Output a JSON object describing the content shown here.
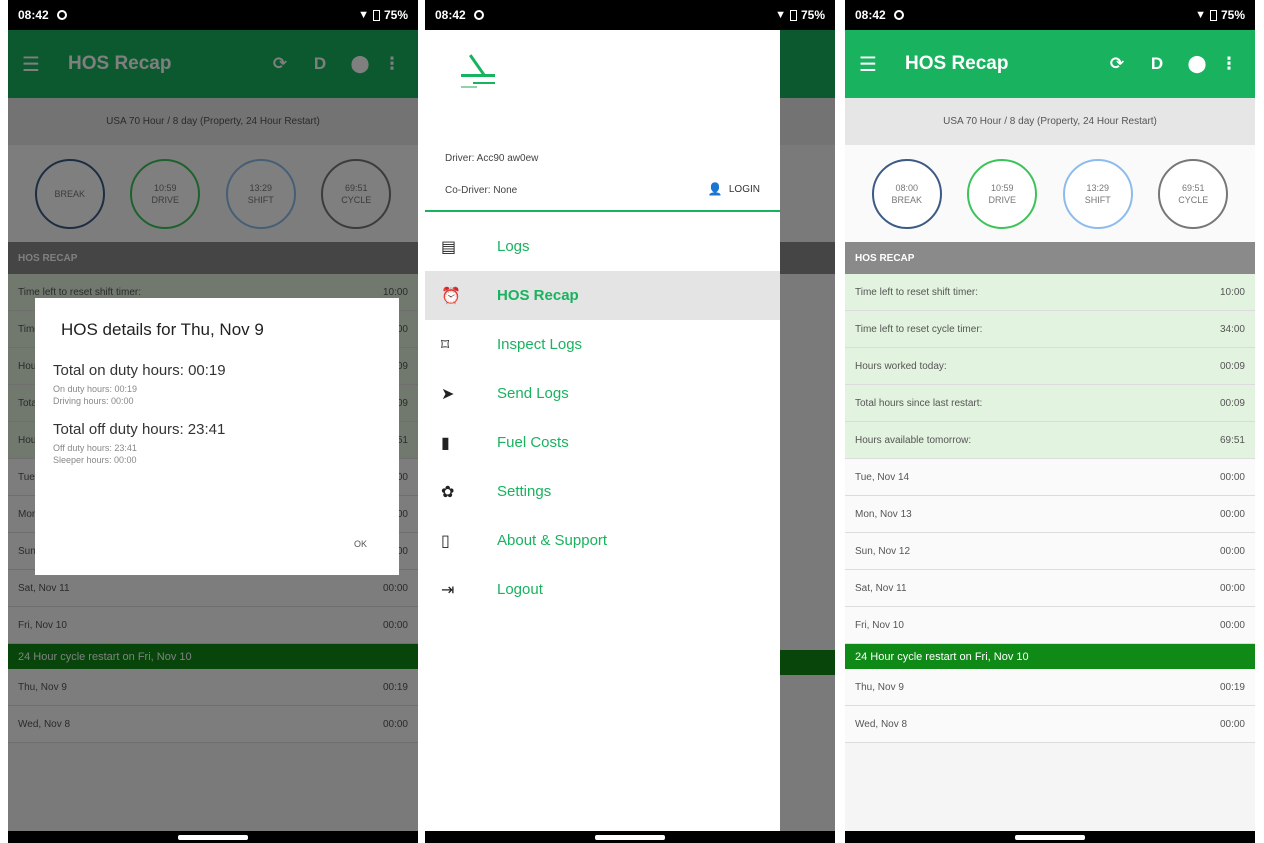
{
  "status_bar": {
    "time": "08:42",
    "battery": "75%"
  },
  "app_bar": {
    "title": "HOS Recap",
    "actions": [
      "D"
    ]
  },
  "ruleset": "USA 70 Hour / 8 day (Property, 24 Hour Restart)",
  "gauges": [
    {
      "value": "08:00",
      "label": "BREAK"
    },
    {
      "value": "10:59",
      "label": "DRIVE"
    },
    {
      "value": "13:29",
      "label": "SHIFT"
    },
    {
      "value": "69:51",
      "label": "CYCLE"
    }
  ],
  "p1_gauges": [
    {
      "value": "BREAK",
      "label": ""
    },
    {
      "value": "10:59",
      "label": "DRIVE"
    },
    {
      "value": "13:29",
      "label": "SHIFT"
    },
    {
      "value": "69:51",
      "label": "CYCLE"
    }
  ],
  "section_title": "HOS RECAP",
  "summary_rows": [
    {
      "label": "Time left to reset shift timer:",
      "value": "10:00"
    },
    {
      "label": "Time left to reset cycle timer:",
      "value": "34:00"
    },
    {
      "label": "Hours worked today:",
      "value": "00:09"
    },
    {
      "label": "Total hours since last restart:",
      "value": "00:09"
    },
    {
      "label": "Hours available tomorrow:",
      "value": "69:51"
    }
  ],
  "day_rows_before": [
    {
      "label": "Tue, Nov 14",
      "value": "00:00"
    },
    {
      "label": "Mon, Nov 13",
      "value": "00:00"
    },
    {
      "label": "Sun, Nov 12",
      "value": "00:00"
    },
    {
      "label": "Sat, Nov 11",
      "value": "00:00"
    },
    {
      "label": "Fri, Nov 10",
      "value": "00:00"
    }
  ],
  "restart_banner": "24 Hour cycle restart on Fri, Nov 10",
  "day_rows_after": [
    {
      "label": "Thu, Nov 9",
      "value": "00:19"
    },
    {
      "label": "Wed, Nov 8",
      "value": "00:00"
    }
  ],
  "dialog": {
    "title": "HOS details for Thu, Nov 9",
    "on_duty_total": "Total on duty hours: 00:19",
    "on_duty_hours": "On duty hours: 00:19",
    "driving_hours": "Driving hours: 00:00",
    "off_duty_total": "Total off duty hours: 23:41",
    "off_duty_hours": "Off duty hours: 23:41",
    "sleeper_hours": "Sleeper hours: 00:00",
    "ok": "OK"
  },
  "drawer": {
    "driver": "Driver: Acc90 aw0ew",
    "co_driver": "Co-Driver: None",
    "login": "LOGIN",
    "items": [
      {
        "label": "Logs"
      },
      {
        "label": "HOS Recap"
      },
      {
        "label": "Inspect Logs"
      },
      {
        "label": "Send Logs"
      },
      {
        "label": "Fuel Costs"
      },
      {
        "label": "Settings"
      },
      {
        "label": "About & Support"
      },
      {
        "label": "Logout"
      }
    ]
  },
  "colors": {
    "brand": "#19b25f",
    "restart_banner": "#0f8a17",
    "summary_row": "#e2f3df"
  },
  "icons": [
    "hamburger-icon",
    "refresh-icon",
    "location-icon",
    "more-vert-icon",
    "logs-icon",
    "alarm-icon",
    "inspect-icon",
    "send-icon",
    "fuel-icon",
    "settings-icon",
    "phone-icon",
    "logout-icon",
    "person-icon"
  ]
}
